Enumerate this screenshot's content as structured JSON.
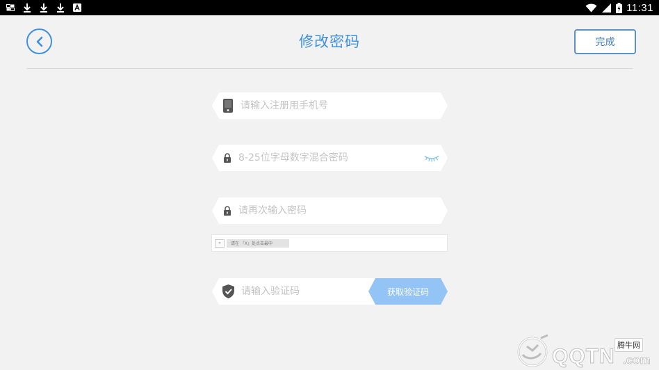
{
  "status_bar": {
    "time": "11:31",
    "left_icons": [
      "gallery-icon",
      "download-icon",
      "download-icon",
      "download-icon",
      "app-icon"
    ],
    "right_icons": [
      "wifi-icon",
      "signal-icon",
      "battery-icon"
    ]
  },
  "header": {
    "title": "修改密码",
    "done_label": "完成",
    "accent_color": "#3d8fe0"
  },
  "form": {
    "phone_placeholder": "请输入注册用手机号",
    "password_placeholder": "8-25位字母数字混合密码",
    "confirm_placeholder": "请再次输入密码",
    "captcha_hint": "请在   「X」处点击最中",
    "code_placeholder": "请输入验证码",
    "get_code_label": "获取验证码",
    "get_code_color": "#94c4f5"
  },
  "watermark": {
    "badge": "腾牛网",
    "brand": "QQTN",
    "suffix": ".com"
  }
}
